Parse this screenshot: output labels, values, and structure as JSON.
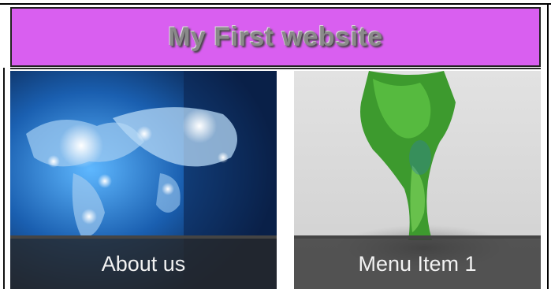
{
  "header": {
    "title": "My First website",
    "background_color": "#d95ff0"
  },
  "tiles": [
    {
      "caption": "About us",
      "image": "world-network-map-image"
    },
    {
      "caption": "Menu Item 1",
      "image": "green-tree-splash-image"
    }
  ]
}
